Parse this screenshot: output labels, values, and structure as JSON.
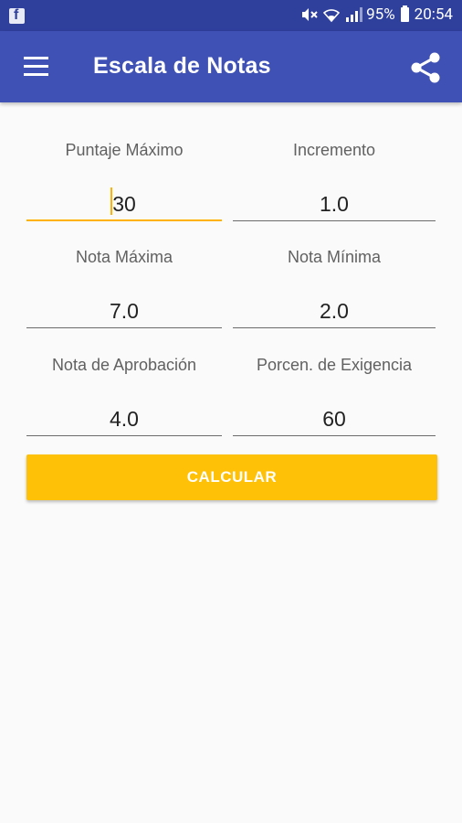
{
  "status_bar": {
    "notification_icon": "facebook-icon",
    "battery": "95%",
    "time": "20:54"
  },
  "app_bar": {
    "title": "Escala de Notas",
    "menu_icon": "hamburger-menu-icon",
    "share_icon": "share-icon"
  },
  "form": {
    "puntaje_maximo": {
      "label": "Puntaje Máximo",
      "value": "30"
    },
    "incremento": {
      "label": "Incremento",
      "value": "1.0"
    },
    "nota_maxima": {
      "label": "Nota Máxima",
      "value": "7.0"
    },
    "nota_minima": {
      "label": "Nota Mínima",
      "value": "2.0"
    },
    "nota_aprobacion": {
      "label": "Nota de Aprobación",
      "value": "4.0"
    },
    "porcen_exigencia": {
      "label": "Porcen. de Exigencia",
      "value": "60"
    }
  },
  "actions": {
    "calcular_label": "CALCULAR"
  },
  "colors": {
    "primary": "#3f51b5",
    "primary_dark": "#2f3f9c",
    "accent": "#ffc107"
  }
}
